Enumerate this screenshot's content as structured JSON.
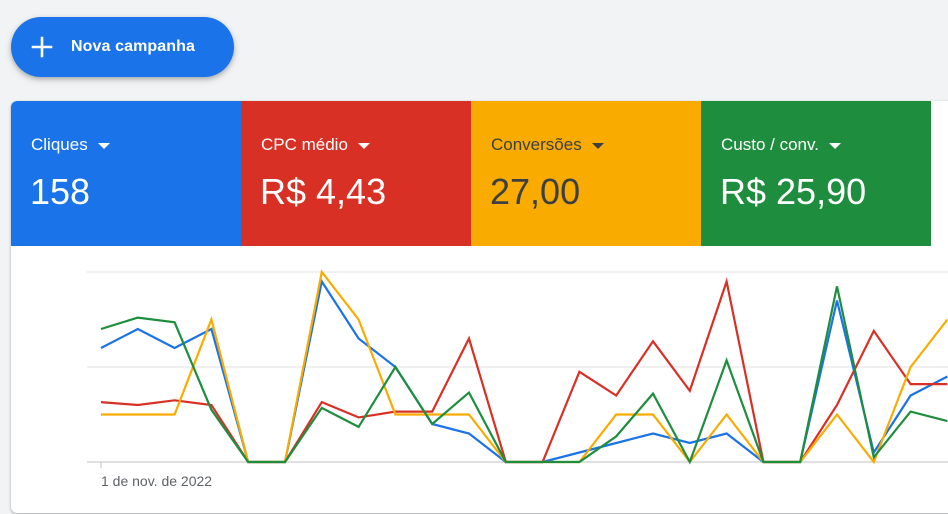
{
  "new_campaign": {
    "label": "Nova campanha",
    "icon": "plus-icon"
  },
  "metrics": [
    {
      "name": "Cliques",
      "value": "158",
      "color": "#1a73e8"
    },
    {
      "name": "CPC médio",
      "value": "R$ 4,43",
      "color": "#d93025"
    },
    {
      "name": "Conversões",
      "value": "27,00",
      "color": "#f9ab00"
    },
    {
      "name": "Custo / conv.",
      "value": "R$ 25,90",
      "color": "#1e8e3e"
    }
  ],
  "chart": {
    "x_start_label": "1 de nov. de 2022"
  },
  "chart_data": {
    "type": "line",
    "x": [
      1,
      2,
      3,
      4,
      5,
      6,
      7,
      8,
      9,
      10,
      11,
      12,
      13,
      14,
      15,
      16,
      17,
      18,
      19,
      20,
      21,
      22,
      23,
      24,
      25,
      26,
      27,
      28,
      29,
      30,
      31,
      32
    ],
    "ylim": [
      0,
      2
    ],
    "grid": true,
    "series": [
      {
        "color": "#1a73e8",
        "values": [
          1.2,
          1.4,
          1.2,
          1.4,
          0,
          0,
          1.9,
          1.3,
          1.0,
          0.4,
          0.3,
          0,
          0,
          0.1,
          0.2,
          0.3,
          0.2,
          0.3,
          0,
          0,
          1.7,
          0.1,
          0.7,
          0.9
        ]
      },
      {
        "color": "#d93025",
        "values": [
          0.63,
          0.6,
          0.65,
          0.6,
          0,
          0,
          0.63,
          0.47,
          0.53,
          0.53,
          1.3,
          0,
          0,
          0.95,
          0.7,
          1.27,
          0.75,
          1.9,
          0,
          0,
          0.6,
          1.38,
          0.82,
          0.82
        ]
      },
      {
        "color": "#f9ab00",
        "values": [
          0.5,
          0.5,
          0.5,
          1.5,
          0,
          0,
          2.0,
          1.5,
          0.5,
          0.5,
          0.5,
          0,
          0,
          0,
          0.5,
          0.5,
          0,
          0.5,
          0,
          0,
          0.5,
          0,
          1.0,
          1.5
        ]
      },
      {
        "color": "#1e8e3e",
        "values": [
          1.4,
          1.52,
          1.47,
          0.55,
          0,
          0,
          0.57,
          0.37,
          1.0,
          0.4,
          0.73,
          0,
          0,
          0,
          0.27,
          0.72,
          0,
          1.07,
          0,
          0,
          1.85,
          0.05,
          0.53,
          0.43
        ]
      }
    ]
  }
}
